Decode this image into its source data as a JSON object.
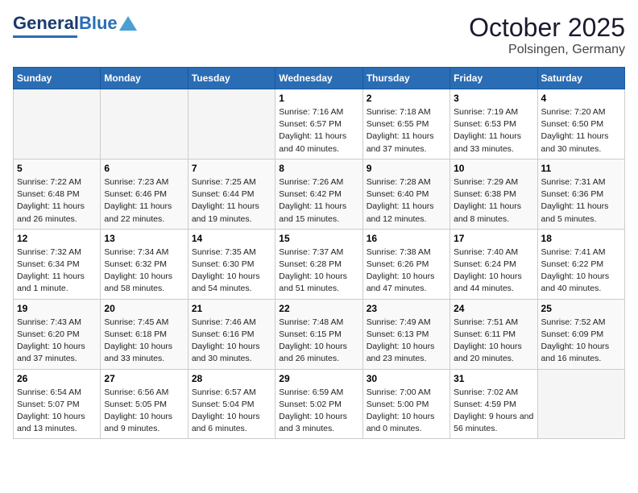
{
  "header": {
    "logo_general": "General",
    "logo_blue": "Blue",
    "month": "October 2025",
    "location": "Polsingen, Germany"
  },
  "weekdays": [
    "Sunday",
    "Monday",
    "Tuesday",
    "Wednesday",
    "Thursday",
    "Friday",
    "Saturday"
  ],
  "weeks": [
    [
      {
        "num": "",
        "info": ""
      },
      {
        "num": "",
        "info": ""
      },
      {
        "num": "",
        "info": ""
      },
      {
        "num": "1",
        "info": "Sunrise: 7:16 AM\nSunset: 6:57 PM\nDaylight: 11 hours and 40 minutes."
      },
      {
        "num": "2",
        "info": "Sunrise: 7:18 AM\nSunset: 6:55 PM\nDaylight: 11 hours and 37 minutes."
      },
      {
        "num": "3",
        "info": "Sunrise: 7:19 AM\nSunset: 6:53 PM\nDaylight: 11 hours and 33 minutes."
      },
      {
        "num": "4",
        "info": "Sunrise: 7:20 AM\nSunset: 6:50 PM\nDaylight: 11 hours and 30 minutes."
      }
    ],
    [
      {
        "num": "5",
        "info": "Sunrise: 7:22 AM\nSunset: 6:48 PM\nDaylight: 11 hours and 26 minutes."
      },
      {
        "num": "6",
        "info": "Sunrise: 7:23 AM\nSunset: 6:46 PM\nDaylight: 11 hours and 22 minutes."
      },
      {
        "num": "7",
        "info": "Sunrise: 7:25 AM\nSunset: 6:44 PM\nDaylight: 11 hours and 19 minutes."
      },
      {
        "num": "8",
        "info": "Sunrise: 7:26 AM\nSunset: 6:42 PM\nDaylight: 11 hours and 15 minutes."
      },
      {
        "num": "9",
        "info": "Sunrise: 7:28 AM\nSunset: 6:40 PM\nDaylight: 11 hours and 12 minutes."
      },
      {
        "num": "10",
        "info": "Sunrise: 7:29 AM\nSunset: 6:38 PM\nDaylight: 11 hours and 8 minutes."
      },
      {
        "num": "11",
        "info": "Sunrise: 7:31 AM\nSunset: 6:36 PM\nDaylight: 11 hours and 5 minutes."
      }
    ],
    [
      {
        "num": "12",
        "info": "Sunrise: 7:32 AM\nSunset: 6:34 PM\nDaylight: 11 hours and 1 minute."
      },
      {
        "num": "13",
        "info": "Sunrise: 7:34 AM\nSunset: 6:32 PM\nDaylight: 10 hours and 58 minutes."
      },
      {
        "num": "14",
        "info": "Sunrise: 7:35 AM\nSunset: 6:30 PM\nDaylight: 10 hours and 54 minutes."
      },
      {
        "num": "15",
        "info": "Sunrise: 7:37 AM\nSunset: 6:28 PM\nDaylight: 10 hours and 51 minutes."
      },
      {
        "num": "16",
        "info": "Sunrise: 7:38 AM\nSunset: 6:26 PM\nDaylight: 10 hours and 47 minutes."
      },
      {
        "num": "17",
        "info": "Sunrise: 7:40 AM\nSunset: 6:24 PM\nDaylight: 10 hours and 44 minutes."
      },
      {
        "num": "18",
        "info": "Sunrise: 7:41 AM\nSunset: 6:22 PM\nDaylight: 10 hours and 40 minutes."
      }
    ],
    [
      {
        "num": "19",
        "info": "Sunrise: 7:43 AM\nSunset: 6:20 PM\nDaylight: 10 hours and 37 minutes."
      },
      {
        "num": "20",
        "info": "Sunrise: 7:45 AM\nSunset: 6:18 PM\nDaylight: 10 hours and 33 minutes."
      },
      {
        "num": "21",
        "info": "Sunrise: 7:46 AM\nSunset: 6:16 PM\nDaylight: 10 hours and 30 minutes."
      },
      {
        "num": "22",
        "info": "Sunrise: 7:48 AM\nSunset: 6:15 PM\nDaylight: 10 hours and 26 minutes."
      },
      {
        "num": "23",
        "info": "Sunrise: 7:49 AM\nSunset: 6:13 PM\nDaylight: 10 hours and 23 minutes."
      },
      {
        "num": "24",
        "info": "Sunrise: 7:51 AM\nSunset: 6:11 PM\nDaylight: 10 hours and 20 minutes."
      },
      {
        "num": "25",
        "info": "Sunrise: 7:52 AM\nSunset: 6:09 PM\nDaylight: 10 hours and 16 minutes."
      }
    ],
    [
      {
        "num": "26",
        "info": "Sunrise: 6:54 AM\nSunset: 5:07 PM\nDaylight: 10 hours and 13 minutes."
      },
      {
        "num": "27",
        "info": "Sunrise: 6:56 AM\nSunset: 5:05 PM\nDaylight: 10 hours and 9 minutes."
      },
      {
        "num": "28",
        "info": "Sunrise: 6:57 AM\nSunset: 5:04 PM\nDaylight: 10 hours and 6 minutes."
      },
      {
        "num": "29",
        "info": "Sunrise: 6:59 AM\nSunset: 5:02 PM\nDaylight: 10 hours and 3 minutes."
      },
      {
        "num": "30",
        "info": "Sunrise: 7:00 AM\nSunset: 5:00 PM\nDaylight: 10 hours and 0 minutes."
      },
      {
        "num": "31",
        "info": "Sunrise: 7:02 AM\nSunset: 4:59 PM\nDaylight: 9 hours and 56 minutes."
      },
      {
        "num": "",
        "info": ""
      }
    ]
  ]
}
